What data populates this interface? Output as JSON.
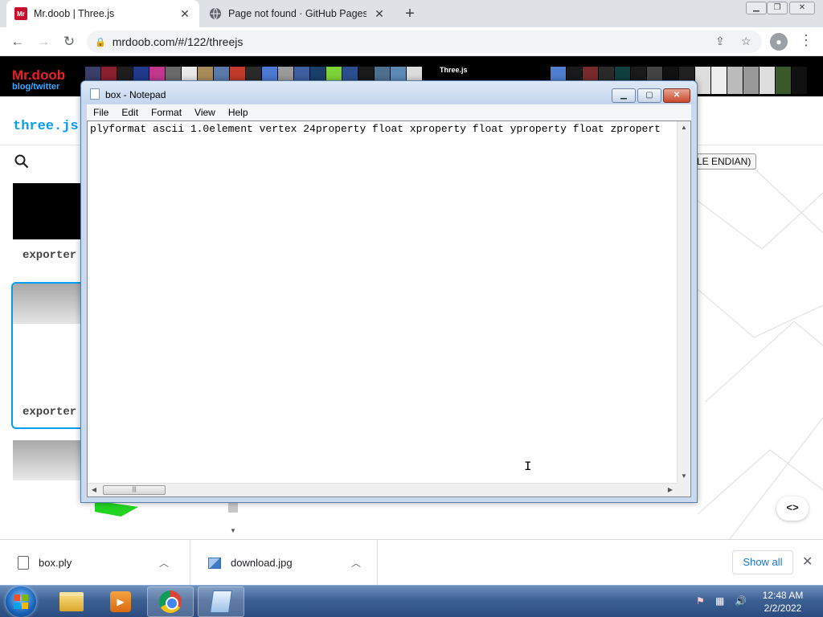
{
  "browser": {
    "tabs": [
      {
        "favicon": "Mr",
        "title": "Mr.doob | Three.js",
        "active": true
      },
      {
        "title": "Page not found · GitHub Pages",
        "active": false
      }
    ],
    "close_glyph": "✕",
    "new_tab_glyph": "+",
    "url": "mrdoob.com/#/122/threejs"
  },
  "page": {
    "logo": "Mr.doob",
    "logo_sub": "blog/twitter",
    "banner_title": "Three.js",
    "left_title": "three.js",
    "card_label_1": "exporter",
    "card_label_2": "exporter",
    "endian_button": "LE ENDIAN)",
    "code_button": "<>"
  },
  "notepad": {
    "title": "box - Notepad",
    "menu": [
      "File",
      "Edit",
      "Format",
      "View",
      "Help"
    ],
    "content": "plyformat ascii 1.0element vertex 24property float xproperty float yproperty float zpropert"
  },
  "downloads": {
    "items": [
      {
        "name": "box.ply",
        "icon": "file-icon"
      },
      {
        "name": "download.jpg",
        "icon": "image-icon"
      }
    ],
    "show_all": "Show all"
  },
  "taskbar": {
    "time": "12:48 AM",
    "date": "2/2/2022"
  },
  "colors": {
    "accent_link": "#049ef4",
    "logo_red": "#e8202a",
    "chrome_blue": "#1a73e8"
  }
}
